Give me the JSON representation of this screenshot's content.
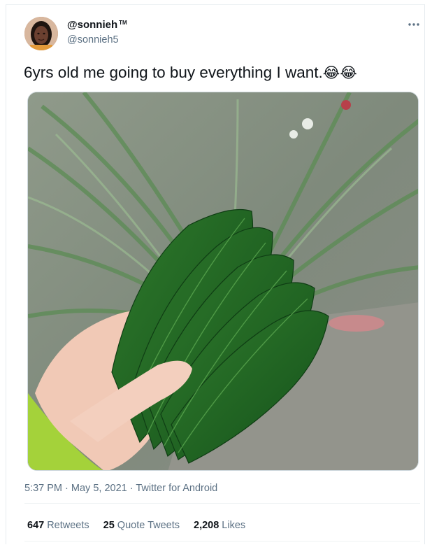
{
  "author": {
    "display_name": "@sonnieh",
    "name_badge": "TM",
    "handle": "@sonnieh5",
    "avatar_icon": "user-avatar"
  },
  "more_icon": "more-horizontal-icon",
  "tweet": {
    "text": "6yrs old me going to buy everything I want.",
    "emojis": "😂😂",
    "media_description_icon": "photo-of-leaves-held-in-hand"
  },
  "meta": {
    "time": "5:37 PM",
    "date": "May 5, 2021",
    "source": "Twitter for Android",
    "separator": "·"
  },
  "stats": {
    "retweets_count": "647",
    "retweets_label": "Retweets",
    "quotes_count": "25",
    "quotes_label": "Quote Tweets",
    "likes_count": "2,208",
    "likes_label": "Likes"
  },
  "colors": {
    "text_primary": "#0f1419",
    "text_secondary": "#5b7083",
    "border": "#cfd9de"
  }
}
